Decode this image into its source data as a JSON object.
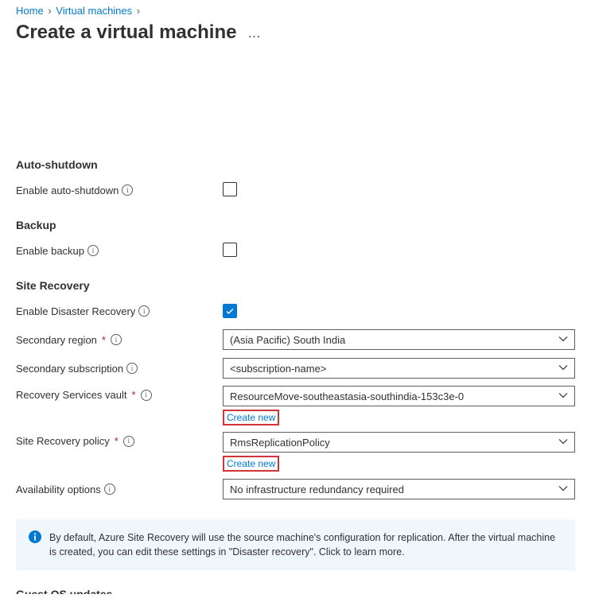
{
  "breadcrumb": {
    "home": "Home",
    "vms": "Virtual machines"
  },
  "page_title": "Create a virtual machine",
  "sections": {
    "autoshutdown": {
      "head": "Auto-shutdown",
      "enable_label": "Enable auto-shutdown",
      "enable_checked": false
    },
    "backup": {
      "head": "Backup",
      "enable_label": "Enable backup",
      "enable_checked": false
    },
    "siterecovery": {
      "head": "Site Recovery",
      "enable_label": "Enable Disaster Recovery",
      "enable_checked": true,
      "secondary_region_label": "Secondary region",
      "secondary_region_value": "(Asia Pacific) South India",
      "secondary_subscription_label": "Secondary subscription",
      "secondary_subscription_value": "<subscription-name>",
      "vault_label": "Recovery Services vault",
      "vault_value": "ResourceMove-southeastasia-southindia-153c3e-0",
      "vault_create": "Create new",
      "policy_label": "Site Recovery policy",
      "policy_value": "RmsReplicationPolicy",
      "policy_create": "Create new",
      "availability_label": "Availability options",
      "availability_value": "No infrastructure redundancy required"
    }
  },
  "infobox": "By default, Azure Site Recovery will use the source machine's configuration for replication. After the virtual machine is created, you can edit these settings in \"Disaster recovery\". Click to learn more.",
  "cutoff_head": "Guest OS updates"
}
